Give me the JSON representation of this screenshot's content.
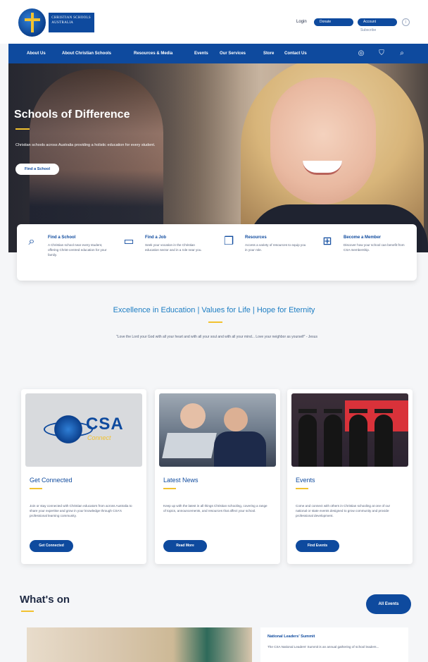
{
  "header": {
    "logo_text": "CHRISTIAN SCHOOLS AUSTRALIA",
    "login_label": "Login",
    "donate_label": "Donate",
    "account_label": "Account",
    "account_sub": "Subscribe",
    "info_icon": "info-icon"
  },
  "nav": {
    "items": [
      "About Us",
      "About Christian Schools",
      "Resources & Media",
      "Events",
      "Our Services",
      "Store",
      "Contact Us"
    ],
    "icons": [
      "user-icon",
      "cart-icon",
      "search-icon"
    ]
  },
  "hero": {
    "title": "Schools of Difference",
    "subtitle": "Christian schools across Australia providing a holistic education for every student.",
    "button_label": "Find a School"
  },
  "features": [
    {
      "icon": "search-icon",
      "title": "Find a School",
      "text": "A Christian school near every student, offering Christ-centred education for your family."
    },
    {
      "icon": "briefcase-icon",
      "title": "Find a Job",
      "text": "Seek your vocation in the Christian education sector and in a role near you."
    },
    {
      "icon": "document-icon",
      "title": "Resources",
      "text": "Access a variety of resources to equip you in your role."
    },
    {
      "icon": "members-icon",
      "title": "Become a Member",
      "text": "Discover how your school can benefit from CSA membership."
    }
  ],
  "tagline": {
    "text": "Excellence in Education  |  Values for Life  |  Hope for Eternity",
    "quote": "\"Love the Lord your God with all your heart and with all your soul and with all your mind... Love your neighbor as yourself\" - Jesus"
  },
  "cards": [
    {
      "title": "Get Connected",
      "text": "Join or stay connected with Christian educators from across Australia to share your expertise and grow in your knowledge through CSA's professional learning community.",
      "button": "Get Connected",
      "image": "csa-connect-logo"
    },
    {
      "title": "Latest News",
      "text": "Keep up with the latest in all things Christian schooling, covering a range of topics, announcements, and resources that affect your school.",
      "button": "Read More",
      "image": "students-laptop-photo"
    },
    {
      "title": "Events",
      "text": "Come and connect with others in Christian schooling at one of our national or state events designed to grow community and provide professional development.",
      "button": "Find Events",
      "image": "graduation-photo"
    }
  ],
  "csa_logo": {
    "word": "CSA",
    "sub": "Connect"
  },
  "whats_on": {
    "title": "What's on",
    "all_events_label": "All Events",
    "event_title": "National Leaders' Summit",
    "event_text": "The CSA National Leaders' Summit is an annual gathering of school leaders..."
  },
  "colors": {
    "brand": "#0e4a9e",
    "accent": "#f2c230",
    "tagline": "#1c7dc3"
  }
}
